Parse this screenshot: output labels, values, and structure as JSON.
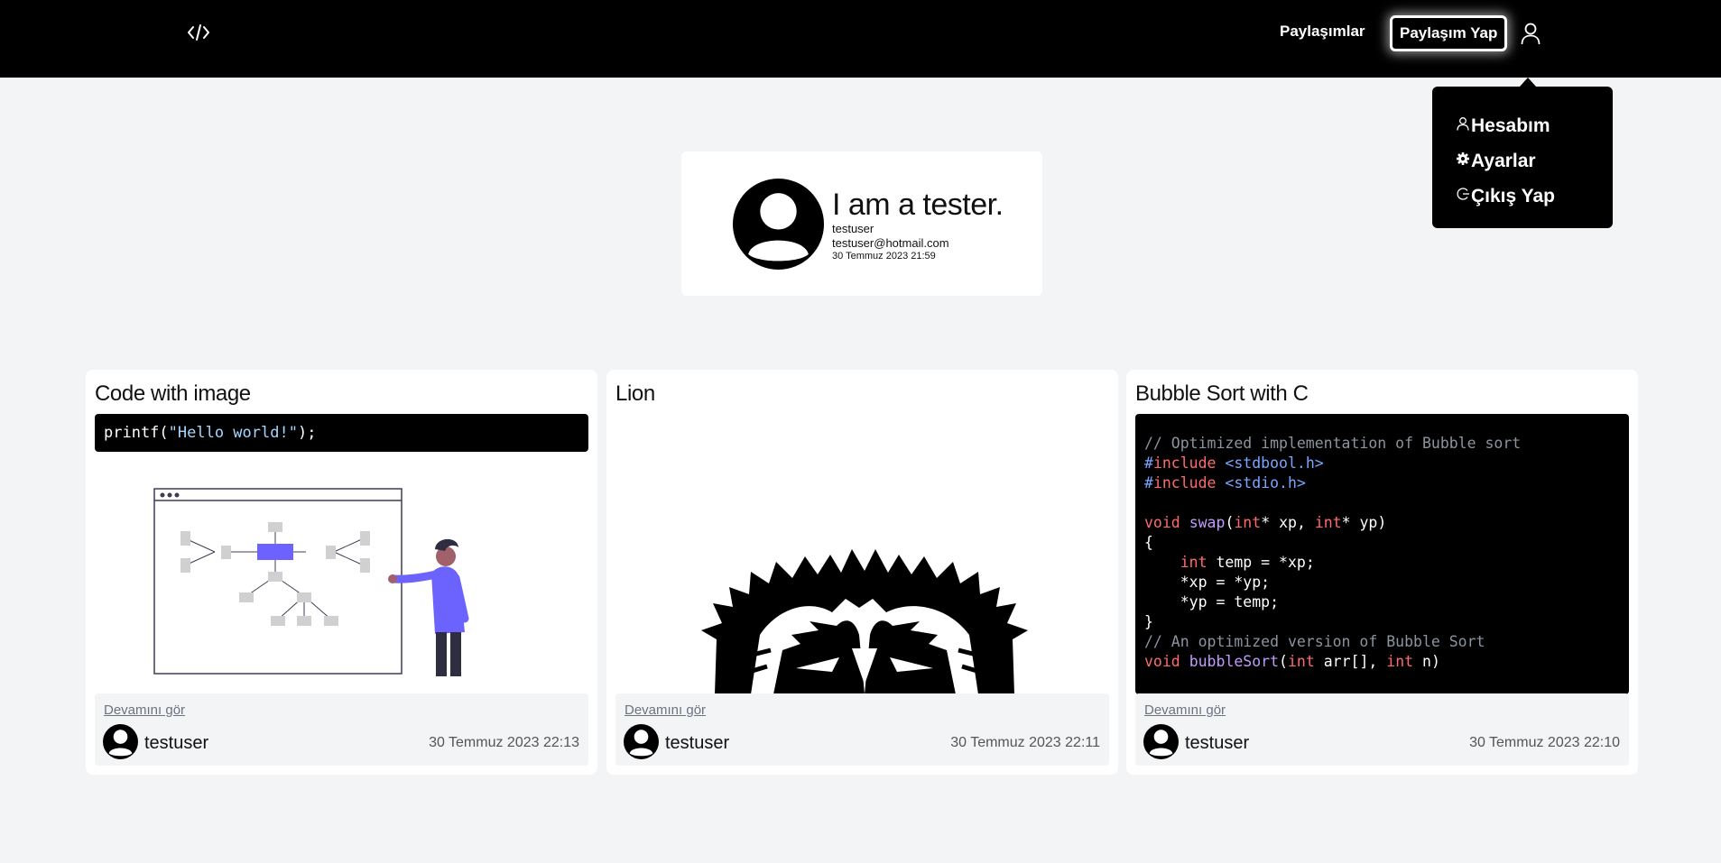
{
  "navbar": {
    "logo_icon": "code-icon",
    "links_label": "Paylaşımlar",
    "share_label": "Paylaşım Yap",
    "user_icon": "user-icon"
  },
  "dropdown": {
    "items": [
      {
        "label": "Hesabım",
        "icon": "user-icon"
      },
      {
        "label": "Ayarlar",
        "icon": "gear-icon"
      },
      {
        "label": "Çıkış Yap",
        "icon": "logout-icon"
      }
    ]
  },
  "profile": {
    "title": "I am a tester.",
    "username": "testuser",
    "email": "testuser@hotmail.com",
    "date": "30 Temmuz 2023 21:59"
  },
  "posts": [
    {
      "title": "Code with image",
      "code": "printf(\"Hello world!\");",
      "more_label": "Devamını gör",
      "author": "testuser",
      "date": "30 Temmuz 2023 22:13"
    },
    {
      "title": "Lion",
      "more_label": "Devamını gör",
      "author": "testuser",
      "date": "30 Temmuz 2023 22:11"
    },
    {
      "title": "Bubble Sort with C",
      "code_lines": [
        "// Optimized implementation of Bubble sort",
        "#include <stdbool.h>",
        "#include <stdio.h>",
        "",
        "void swap(int* xp, int* yp)",
        "{",
        "    int temp = *xp;",
        "    *xp = *yp;",
        "    *yp = temp;",
        "}",
        "// An optimized version of Bubble Sort",
        "void bubbleSort(int arr[], int n)"
      ],
      "more_label": "Devamını gör",
      "author": "testuser",
      "date": "30 Temmuz 2023 22:10"
    }
  ]
}
